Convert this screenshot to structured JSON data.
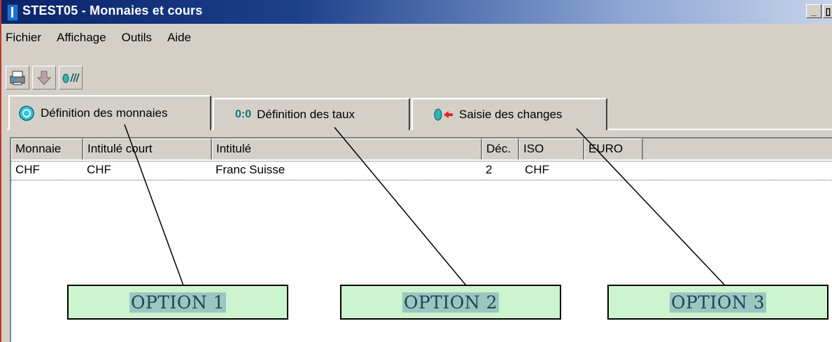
{
  "window": {
    "title": "STEST05 - Monnaies et cours",
    "minimize_glyph": "_",
    "restore_glyph": "▯"
  },
  "menu": [
    "Fichier",
    "Affichage",
    "Outils",
    "Aide"
  ],
  "toolbar": {
    "buttons": [
      "print-icon",
      "down-arrow-icon",
      "exchange-icon"
    ],
    "exchange_glyph": "0↗↙"
  },
  "tabs": [
    {
      "label": "Définition des monnaies",
      "icon": "currency-coin-icon",
      "active": true
    },
    {
      "label": "Définition des taux",
      "icon": "rate-icon",
      "glyph": "0:0",
      "active": false
    },
    {
      "label": "Saisie des changes",
      "icon": "exchange-entry-icon",
      "active": false
    }
  ],
  "grid": {
    "columns": [
      "Monnaie",
      "Intitulé court",
      "Intitulé",
      "Déc.",
      "ISO",
      "EURO"
    ],
    "rows": [
      [
        "CHF",
        "CHF",
        "Franc Suisse",
        "2",
        "CHF",
        ""
      ]
    ]
  },
  "callouts": [
    "OPTION 1",
    "OPTION 2",
    "OPTION 3"
  ],
  "colors": {
    "title_bar": "#0a246a",
    "callout_fill": "#ccf5cf",
    "callout_text_highlight": "#9ac8c0"
  }
}
